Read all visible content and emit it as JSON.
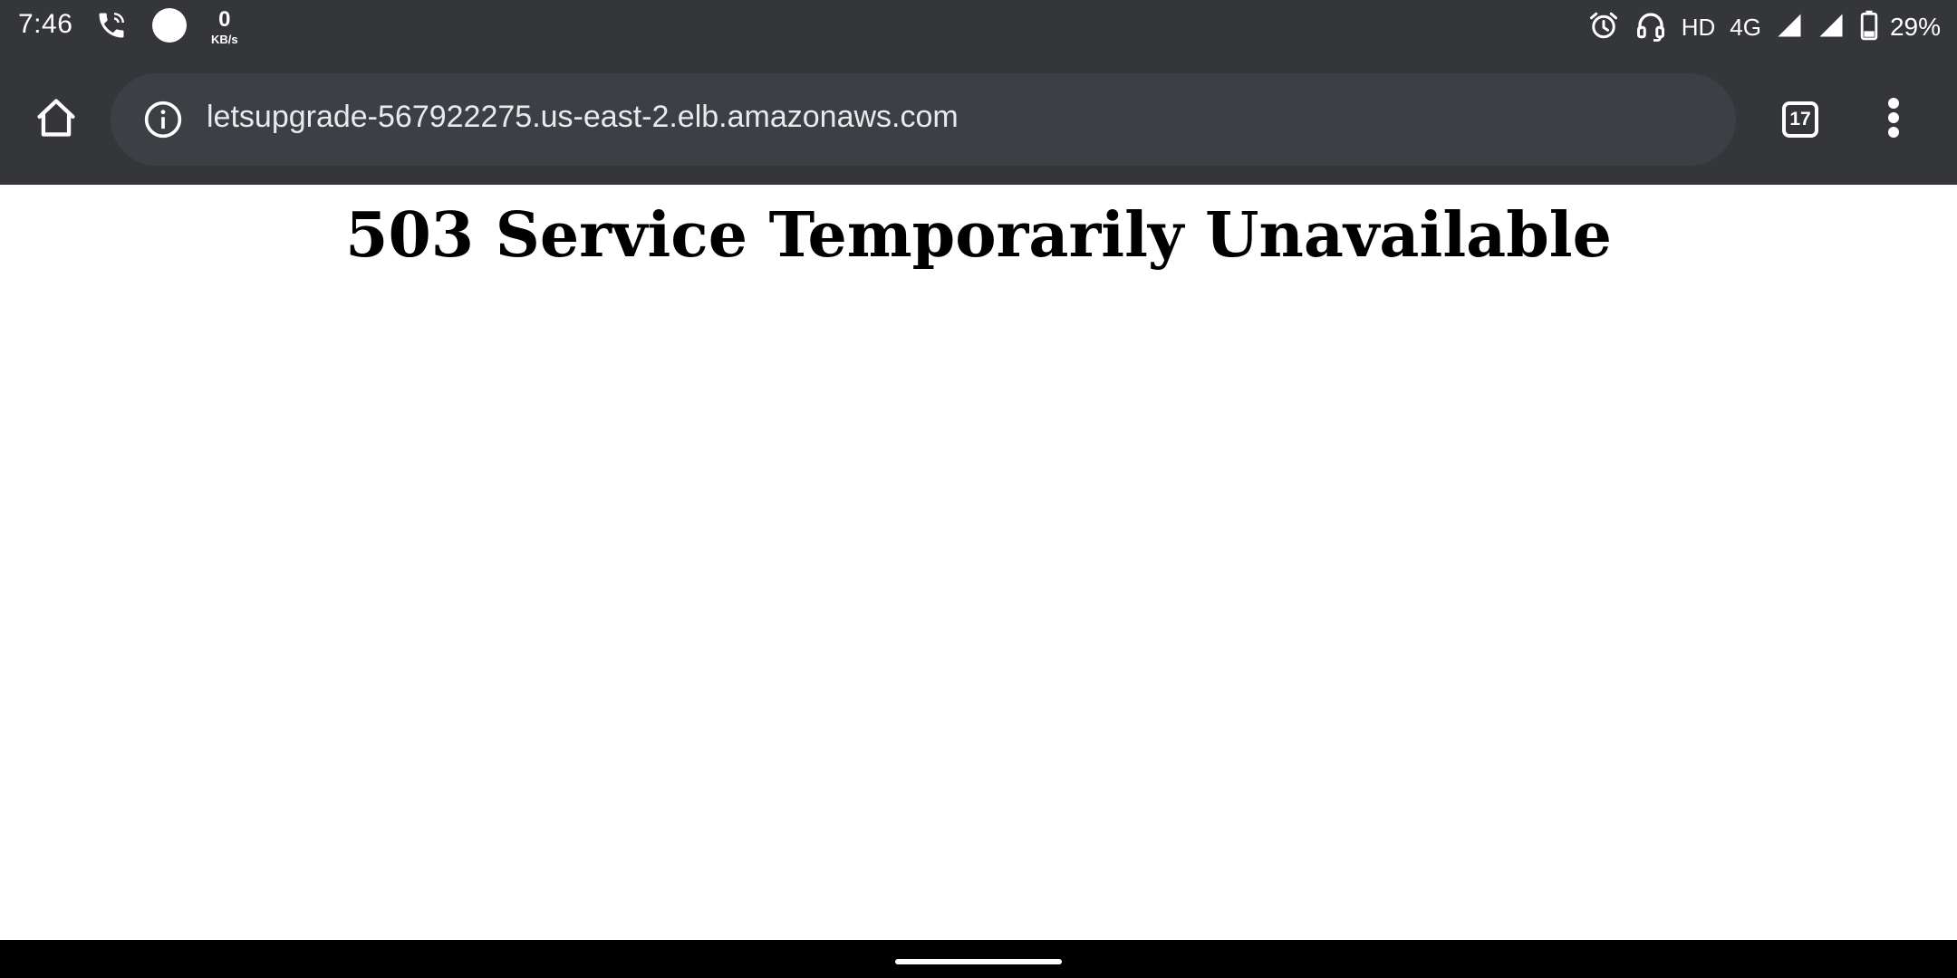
{
  "status_bar": {
    "time": "7:46",
    "net_speed_value": "0",
    "net_speed_unit": "KB/s",
    "hd_label": "HD",
    "network_type": "4G",
    "battery_percent": "29%",
    "icons": [
      "call-forward-icon",
      "circle-icon",
      "alarm-icon",
      "headset-icon",
      "signal-icon",
      "signal-icon",
      "battery-icon"
    ]
  },
  "toolbar": {
    "home_icon": "home-icon",
    "info_icon": "info-icon",
    "url": "letsupgrade-567922275.us-east-2.elb.amazonaws.com",
    "tab_count": "17",
    "menu_icon": "more-vert-icon"
  },
  "page": {
    "heading": "503 Service Temporarily Unavailable"
  },
  "colors": {
    "chrome_bar": "#35363a",
    "omnibox": "#3c3f43",
    "url_text": "#e8eaed",
    "page_background": "#ffffff",
    "nav_bar": "#000000"
  }
}
